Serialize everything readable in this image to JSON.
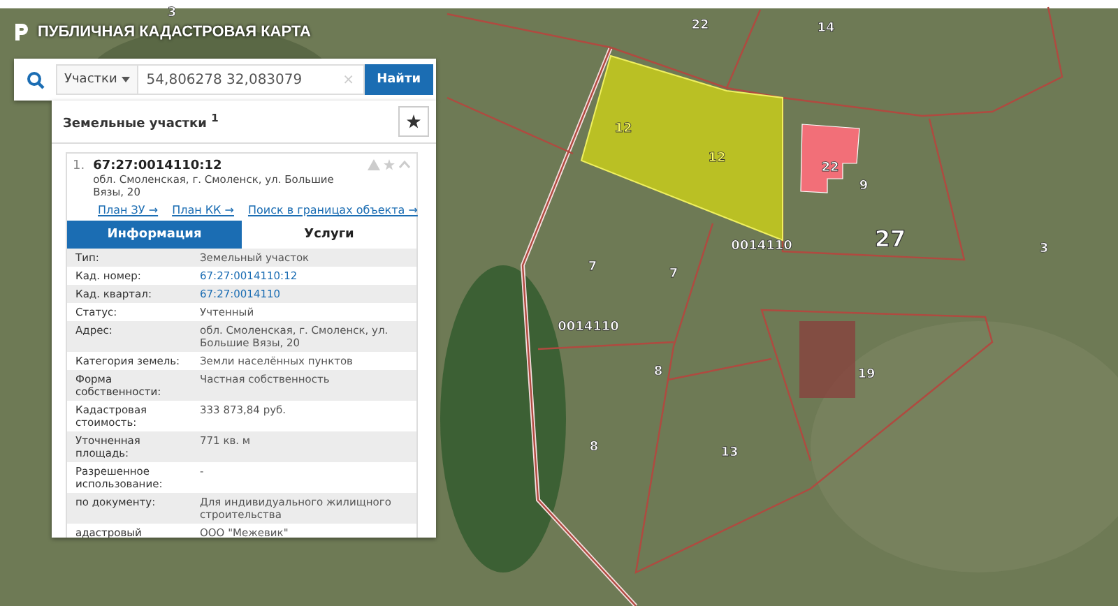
{
  "header": {
    "title": "ПУБЛИЧНАЯ КАДАСТРОВАЯ КАРТА"
  },
  "search": {
    "category": "Участки",
    "value": "54,806278 32,083079",
    "clear": "×",
    "button": "Найти"
  },
  "results": {
    "title": "Земельные участки $^{1}$",
    "items": [
      {
        "number": "1.",
        "cad_number": "67:27:0014110:12",
        "address": "обл. Смоленская, г. Смоленск, ул. Большие Вязы, 20",
        "links": [
          "План ЗУ →",
          "План КК →",
          "Поиск в границах объекта →"
        ],
        "tabs": [
          {
            "label": "Информация",
            "selected": true
          },
          {
            "label": "Услуги",
            "selected": false
          }
        ],
        "fields": [
          {
            "label": "Тип:",
            "value": "Земельный участок",
            "kind": "text"
          },
          {
            "label": "Кад. номер:",
            "value": "67:27:0014110:12",
            "kind": "link"
          },
          {
            "label": "Кад. квартал:",
            "value": "67:27:0014110",
            "kind": "link"
          },
          {
            "label": "Статус:",
            "value": "Учтенный",
            "kind": "text"
          },
          {
            "label": "Адрес:",
            "value": "обл. Смоленская, г. Смоленск, ул. Большие Вязы, 20",
            "kind": "text"
          },
          {
            "label": "Категория земель:",
            "value": "Земли населённых пунктов",
            "kind": "text"
          },
          {
            "label": "Форма собственности:",
            "value": "Частная собственность",
            "kind": "text"
          },
          {
            "label": "Кадастровая стоимость:",
            "value": "333 873,84 руб.",
            "kind": "text"
          },
          {
            "label": "Уточненная площадь:",
            "value": "771 кв. м",
            "kind": "text"
          },
          {
            "label": "Разрешенное использование:",
            "value": "-",
            "kind": "text"
          },
          {
            "label": "по документу:",
            "value": "Для индивидуального жилищного строительства",
            "kind": "text"
          },
          {
            "label": "адастровый",
            "value": "ООО \"Межевик\"",
            "kind": "text"
          }
        ]
      }
    ]
  },
  "map": {
    "labels": [
      "3",
      "22",
      "14",
      "12",
      "12",
      "22",
      "9",
      "0014110",
      "27",
      "3",
      "7",
      "7",
      "0014110",
      "8",
      "19",
      "8",
      "13"
    ]
  }
}
